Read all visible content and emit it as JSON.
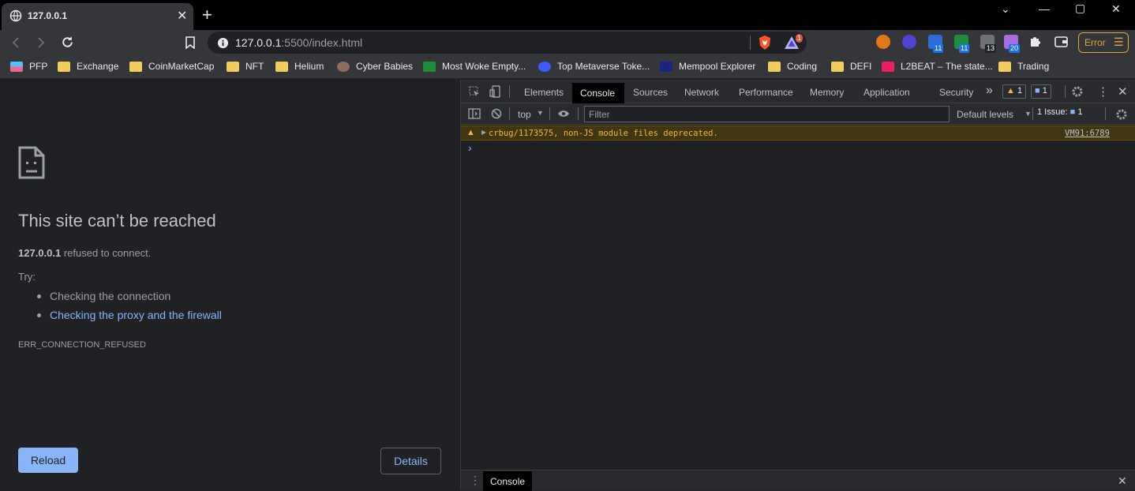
{
  "tab": {
    "title": "127.0.0.1",
    "close": "✕",
    "new_tab": "+"
  },
  "window": {
    "minimize": "—",
    "maximize": "▢",
    "close": "✕",
    "tabsearch": "⌄"
  },
  "omnibox": {
    "host": "127.0.0.1",
    "rest": ":5500/index.html",
    "brave_badge": "1"
  },
  "toolbar": {
    "error_label": "Error",
    "ext_badges": [
      "11",
      "11",
      "13",
      "20"
    ]
  },
  "bookmarks": [
    {
      "label": "PFP",
      "icon": "pfp-icon"
    },
    {
      "label": "Exchange",
      "icon": "folder-icon"
    },
    {
      "label": "CoinMarketCap",
      "icon": "folder-icon"
    },
    {
      "label": "NFT",
      "icon": "folder-icon"
    },
    {
      "label": "Helium",
      "icon": "folder-icon"
    },
    {
      "label": "Cyber Babies",
      "icon": "cyber-babies-icon"
    },
    {
      "label": "Most Woke Empty...",
      "icon": "sheets-icon"
    },
    {
      "label": "Top Metaverse Toke...",
      "icon": "at-icon"
    },
    {
      "label": "Mempool Explorer",
      "icon": "mempool-icon"
    },
    {
      "label": "Coding",
      "icon": "folder-icon"
    },
    {
      "label": "DEFI",
      "icon": "folder-icon"
    },
    {
      "label": "L2BEAT – The state...",
      "icon": "l2beat-icon"
    },
    {
      "label": "Trading",
      "icon": "folder-icon"
    }
  ],
  "error_page": {
    "heading": "This site can’t be reached",
    "host": "127.0.0.1",
    "refused": " refused to connect.",
    "try": "Try:",
    "suggestions": [
      "Checking the connection",
      "Checking the proxy and the firewall"
    ],
    "code": "ERR_CONNECTION_REFUSED",
    "reload": "Reload",
    "details": "Details"
  },
  "devtools": {
    "tabs": [
      "Elements",
      "Console",
      "Sources",
      "Network",
      "Performance",
      "Memory",
      "Application",
      "Security"
    ],
    "more": "»",
    "warn_count": "1",
    "info_count": "1",
    "context": "top",
    "filter_placeholder": "Filter",
    "levels": "Default levels",
    "issues": "1 Issue:",
    "issues_count": "1",
    "warning_message": "crbug/1173575, non-JS module files deprecated.",
    "warning_source": "VM91:6789",
    "prompt": "›",
    "drawer_tab": "Console"
  },
  "colors": {
    "accent": "#8ab4f8",
    "warning": "#f2b835",
    "error": "#e3a545"
  }
}
